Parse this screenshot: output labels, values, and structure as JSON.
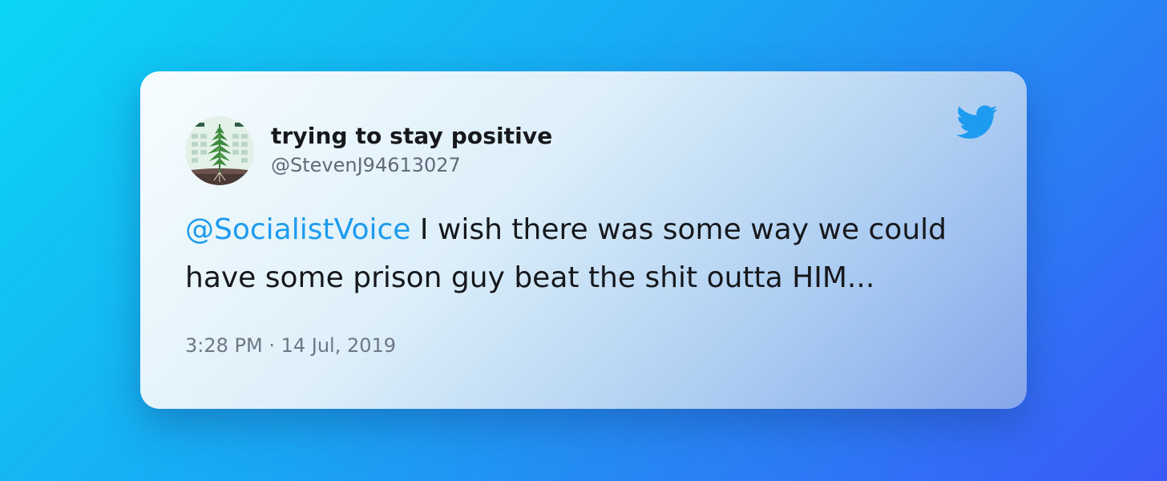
{
  "tweet": {
    "display_name": "trying to stay positive",
    "handle": "@StevenJ94613027",
    "mention": "@SocialistVoice",
    "text": " I wish there was some way we could have some prison guy beat the shit outta HIM...",
    "timestamp": "3:28 PM · 14 Jul, 2019"
  },
  "icons": {
    "brand": "twitter-bird-icon",
    "avatar": "cannabis-plant-avatar"
  },
  "colors": {
    "brand_blue": "#1d9bf0",
    "text": "#16181c",
    "muted": "#6c7783"
  }
}
